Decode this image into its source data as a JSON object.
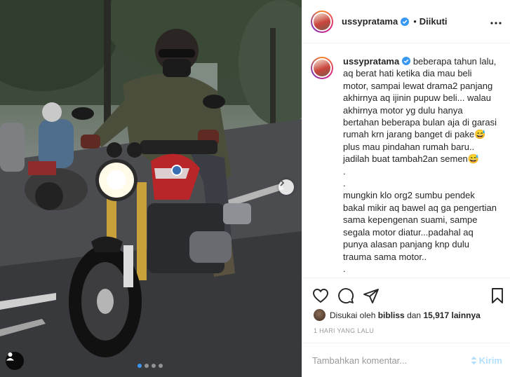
{
  "post": {
    "username": "ussypratama",
    "follow_separator": "•",
    "follow_status": "Diikuti",
    "more_icon": "more-horizontal-icon"
  },
  "caption": {
    "username": "ussypratama",
    "text": " beberapa tahun lalu,\naq berat hati ketika dia mau beli\nmotor, sampai lewat drama2 panjang\nakhirnya aq ijinin pupuw beli... walau\nakhirnya motor yg dulu hanya\nbertahan beberapa bulan aja di garasi\nrumah krn jarang banget di pake😅\nplus mau pindahan rumah baru..\njadilah buat tambah2an semen😅\n.\n.\nmungkin klo org2 sumbu pendek\nbakal mikir aq bawel aq ga pengertian\nsama kepengenan suami, sampe\nsegala motor diatur...padahal aq\npunya alasan panjang knp dulu\ntrauma sama motor..\n.\n.\nsampai akhirnya Saka lahir.. entah knp"
  },
  "likes": {
    "prefix": "Disukai oleh",
    "liker": "bibliss",
    "conjunction": "dan",
    "count_text": "15,917 lainnya"
  },
  "timestamp": "1 HARI YANG LALU",
  "comment": {
    "placeholder": "Tambahkan komentar...",
    "send_label": "Kirim"
  },
  "carousel": {
    "total": 4,
    "active": 1
  },
  "colors": {
    "verified": "#3897f0",
    "dot_active": "#3897f0",
    "send_disabled": "#b2dffc"
  }
}
